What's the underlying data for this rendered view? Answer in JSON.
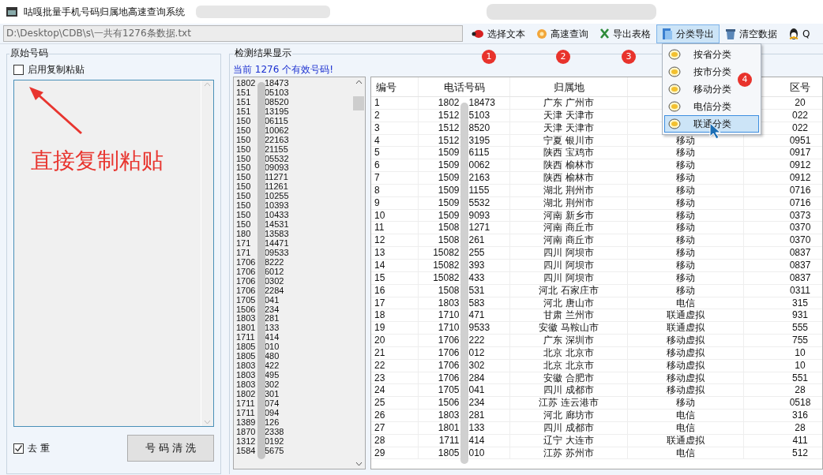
{
  "window": {
    "title": "咕嘎批量手机号码归属地高速查询系统"
  },
  "toolbar": {
    "path": "D:\\Desktop\\CDB\\s\\一共有1276条数据.txt",
    "buttons": [
      {
        "label": "选择文本",
        "kind": "select",
        "pressed": false,
        "badge": "1"
      },
      {
        "label": "高速查询",
        "kind": "query",
        "pressed": false,
        "badge": "2"
      },
      {
        "label": "导出表格",
        "kind": "export",
        "pressed": false,
        "badge": "3"
      },
      {
        "label": "分类导出",
        "kind": "classify",
        "pressed": true
      },
      {
        "label": "清空数据",
        "kind": "clear",
        "pressed": false
      },
      {
        "label": "Q",
        "kind": "qq",
        "pressed": false
      }
    ]
  },
  "menu": {
    "badge": "4",
    "items": [
      {
        "label": "按省分类",
        "selected": false
      },
      {
        "label": "按市分类",
        "selected": false
      },
      {
        "label": "移动分类",
        "selected": false
      },
      {
        "label": "电信分类",
        "selected": false
      },
      {
        "label": "联通分类",
        "selected": true
      }
    ]
  },
  "source_panel": {
    "title": "原始号码",
    "paste_checkbox": {
      "label": "启用复制粘贴",
      "checked": false
    },
    "annotation": "直接复制粘贴",
    "dedupe_checkbox": {
      "label": "去 重",
      "checked": true
    },
    "clean_button": "号 码 清 洗"
  },
  "results_panel": {
    "title": "检测结果显示",
    "status": "当前 1276 个有效号码!",
    "numbers": [
      {
        "head": "1802",
        "tail": "18473"
      },
      {
        "head": "151",
        "tail": "05103"
      },
      {
        "head": "151",
        "tail": "08520"
      },
      {
        "head": "151",
        "tail": "13195"
      },
      {
        "head": "150",
        "tail": "06115"
      },
      {
        "head": "150",
        "tail": "10062"
      },
      {
        "head": "150",
        "tail": "22163"
      },
      {
        "head": "150",
        "tail": "21155"
      },
      {
        "head": "150",
        "tail": "05532"
      },
      {
        "head": "150",
        "tail": "09093"
      },
      {
        "head": "150",
        "tail": "11271"
      },
      {
        "head": "150",
        "tail": "11261"
      },
      {
        "head": "150",
        "tail": "10255"
      },
      {
        "head": "150",
        "tail": "10393"
      },
      {
        "head": "150",
        "tail": "10433"
      },
      {
        "head": "150",
        "tail": "14531"
      },
      {
        "head": "180",
        "tail": "13583"
      },
      {
        "head": "171",
        "tail": "14471"
      },
      {
        "head": "171",
        "tail": "09533"
      },
      {
        "head": "1706",
        "tail": "8222"
      },
      {
        "head": "1706",
        "tail": "6012"
      },
      {
        "head": "1706",
        "tail": "0302"
      },
      {
        "head": "1706",
        "tail": "2284"
      },
      {
        "head": "1705",
        "tail": "041"
      },
      {
        "head": "1506",
        "tail": "234"
      },
      {
        "head": "1803",
        "tail": "281"
      },
      {
        "head": "1801",
        "tail": "133"
      },
      {
        "head": "1711",
        "tail": "414"
      },
      {
        "head": "1805",
        "tail": "010"
      },
      {
        "head": "1805",
        "tail": "480"
      },
      {
        "head": "1803",
        "tail": "422"
      },
      {
        "head": "1803",
        "tail": "495"
      },
      {
        "head": "1803",
        "tail": "302"
      },
      {
        "head": "1802",
        "tail": "301"
      },
      {
        "head": "1711",
        "tail": "074"
      },
      {
        "head": "1711",
        "tail": "094"
      },
      {
        "head": "1389",
        "tail": "126"
      },
      {
        "head": "1870",
        "tail": "2338"
      },
      {
        "head": "1312",
        "tail": "0192"
      },
      {
        "head": "1584",
        "tail": "5675"
      }
    ],
    "table": {
      "columns": [
        "编号",
        "电话号码",
        "归属地",
        "区号"
      ],
      "rows": [
        {
          "no": "1",
          "head": "1802",
          "tail": "18473",
          "location": "广东 广州市",
          "area_code": "20"
        },
        {
          "no": "2",
          "head": "1512",
          "tail": "5103",
          "location": "天津 天津市",
          "area_code": "022"
        },
        {
          "no": "3",
          "head": "1512",
          "tail": "8520",
          "location": "天津 天津市",
          "area_code": "022"
        },
        {
          "no": "4",
          "head": "1512",
          "tail": "3195",
          "location": "宁夏 银川市",
          "carrier": "移动",
          "area_code": "0951"
        },
        {
          "no": "5",
          "head": "1509",
          "tail": "6115",
          "location": "陕西 宝鸡市",
          "carrier": "移动",
          "area_code": "0917"
        },
        {
          "no": "6",
          "head": "1509",
          "tail": "0062",
          "location": "陕西 榆林市",
          "carrier": "移动",
          "area_code": "0912"
        },
        {
          "no": "7",
          "head": "1509",
          "tail": "2163",
          "location": "陕西 榆林市",
          "carrier": "移动",
          "area_code": "0912"
        },
        {
          "no": "8",
          "head": "1509",
          "tail": "1155",
          "location": "湖北 荆州市",
          "carrier": "移动",
          "area_code": "0716"
        },
        {
          "no": "9",
          "head": "1509",
          "tail": "5532",
          "location": "湖北 荆州市",
          "carrier": "移动",
          "area_code": "0716"
        },
        {
          "no": "10",
          "head": "1509",
          "tail": "9093",
          "location": "河南 新乡市",
          "carrier": "移动",
          "area_code": "0373"
        },
        {
          "no": "11",
          "head": "1508",
          "tail": "1271",
          "location": "河南 商丘市",
          "carrier": "移动",
          "area_code": "0370"
        },
        {
          "no": "12",
          "head": "1508",
          "tail": "261",
          "location": "河南 商丘市",
          "carrier": "移动",
          "area_code": "0370"
        },
        {
          "no": "13",
          "head": "15082",
          "tail": "255",
          "location": "四川 阿坝市",
          "carrier": "移动",
          "area_code": "0837"
        },
        {
          "no": "14",
          "head": "15082",
          "tail": "393",
          "location": "四川 阿坝市",
          "carrier": "移动",
          "area_code": "0837"
        },
        {
          "no": "15",
          "head": "15082",
          "tail": "433",
          "location": "四川 阿坝市",
          "carrier": "移动",
          "area_code": "0837"
        },
        {
          "no": "16",
          "head": "1508",
          "tail": "531",
          "location": "河北 石家庄市",
          "carrier": "移动",
          "area_code": "0311"
        },
        {
          "no": "17",
          "head": "1803",
          "tail": "583",
          "location": "河北 唐山市",
          "carrier": "电信",
          "area_code": "315"
        },
        {
          "no": "18",
          "head": "1710",
          "tail": "471",
          "location": "甘肃 兰州市",
          "carrier": "联通虚拟",
          "area_code": "931"
        },
        {
          "no": "19",
          "head": "1710",
          "tail": "9533",
          "location": "安徽 马鞍山市",
          "carrier": "联通虚拟",
          "area_code": "555"
        },
        {
          "no": "20",
          "head": "1706",
          "tail": "222",
          "location": "广东 深圳市",
          "carrier": "移动虚拟",
          "area_code": "755"
        },
        {
          "no": "21",
          "head": "1706",
          "tail": "012",
          "location": "北京 北京市",
          "carrier": "移动虚拟",
          "area_code": "10"
        },
        {
          "no": "22",
          "head": "1706",
          "tail": "302",
          "location": "北京 北京市",
          "carrier": "移动虚拟",
          "area_code": "10"
        },
        {
          "no": "23",
          "head": "1706",
          "tail": "284",
          "location": "安徽 合肥市",
          "carrier": "移动虚拟",
          "area_code": "551"
        },
        {
          "no": "24",
          "head": "1705",
          "tail": "041",
          "location": "四川 成都市",
          "carrier": "移动虚拟",
          "area_code": "28"
        },
        {
          "no": "25",
          "head": "1506",
          "tail": "234",
          "location": "江苏 连云港市",
          "carrier": "移动",
          "area_code": "0518"
        },
        {
          "no": "26",
          "head": "1803",
          "tail": "281",
          "location": "河北 廊坊市",
          "carrier": "电信",
          "area_code": "316"
        },
        {
          "no": "27",
          "head": "1801",
          "tail": "133",
          "location": "四川 成都市",
          "carrier": "电信",
          "area_code": "28"
        },
        {
          "no": "28",
          "head": "1711",
          "tail": "414",
          "location": "辽宁 大连市",
          "carrier": "联通虚拟",
          "area_code": "411"
        },
        {
          "no": "29",
          "head": "1805",
          "tail": "010",
          "location": "江苏 苏州市",
          "carrier": "电信",
          "area_code": "512"
        }
      ]
    }
  }
}
